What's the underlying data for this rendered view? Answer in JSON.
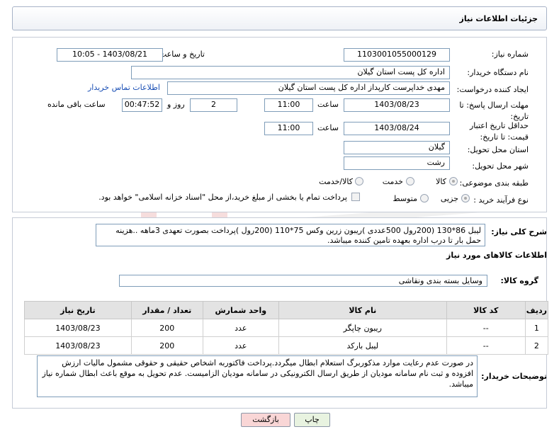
{
  "header": {
    "title": "جزئیات اطلاعات نیاز"
  },
  "form": {
    "need_number_label": "شماره نیاز:",
    "need_number": "1103001055000129",
    "announce_label": "تاریخ و ساعت اعلان عمومی:",
    "announce_value": "1403/08/21 - 10:05",
    "buyer_org_label": "نام دستگاه خریدار:",
    "buyer_org": "اداره کل پست استان گیلان",
    "requester_label": "ایجاد کننده درخواست:",
    "requester": "مهدی  خداپرست  کارپداز  اداره کل پست استان گیلان",
    "buyer_contact_link": "اطلاعات تماس خریدار",
    "deadline_label": "مهلت ارسال پاسخ: تا تاریخ:",
    "deadline_date": "1403/08/23",
    "time_label": "ساعت",
    "deadline_time": "11:00",
    "days_value": "2",
    "days_label": "روز و",
    "remaining_time": "00:47:52",
    "remaining_label": "ساعت باقی مانده",
    "validity_label": "حداقل تاریخ اعتبار قیمت: تا تاریخ:",
    "validity_date": "1403/08/24",
    "validity_time": "11:00",
    "province_label": "استان محل تحویل:",
    "province": "گیلان",
    "city_label": "شهر محل تحویل:",
    "city": "رشت",
    "category_label": "طبقه بندی موضوعی:",
    "category_options": [
      "کالا",
      "خدمت",
      "کالا/خدمت"
    ],
    "purchase_type_label": "نوع فرآیند خرید :",
    "purchase_options": [
      "جزیی",
      "متوسط"
    ],
    "treasury_note": "پرداخت تمام یا بخشی از مبلغ خرید،از محل \"اسناد خزانه اسلامی\" خواهد بود."
  },
  "details": {
    "general_desc_label": "شرح کلی نیاز:",
    "general_desc": "لیبل 86*130 (200رول 500عددی )ریبون زرین وکس 75*110 (200رول )پرداخت بصورت تعهدی 3ماهه ..هزینه حمل بار تا درب اداره بعهده تامین کننده میباشد.",
    "goods_info_title": "اطلاعات کالاهای مورد نیاز",
    "goods_group_label": "گروه کالا:",
    "goods_group": "وسایل بسته بندی  ونقاشی",
    "table_headers": [
      "ردیف",
      "کد کالا",
      "نام کالا",
      "واحد شمارش",
      "تعداد / مقدار",
      "تاریخ نیاز"
    ],
    "rows": [
      [
        "1",
        "--",
        "ریبون چاپگر",
        "عدد",
        "200",
        "1403/08/23"
      ],
      [
        "2",
        "--",
        "لیبل بارکد",
        "عدد",
        "200",
        "1403/08/23"
      ]
    ],
    "buyer_notes_label": "توضیحات خریدار:",
    "buyer_notes": "در صورت عدم رعایت موارد مذکوربرگ استعلام ابطال میگردد.پرداخت فاکتوربه اشخاص حقیقی و حقوقی مشمول مالیات ارزش افزوده و ثبت نام سامانه مودیان از طریق ارسال الکترونیکی در سامانه مودیان الزامیست. عدم تحویل به موقع باعث ابطال شماره نیاز میباشد."
  },
  "buttons": {
    "print": "چاپ",
    "back": "بازگشت"
  },
  "colors": {
    "link": "#1a4fb5",
    "back_button_bg": "#f9d6d6",
    "print_button_bg": "#e8f3e0"
  }
}
